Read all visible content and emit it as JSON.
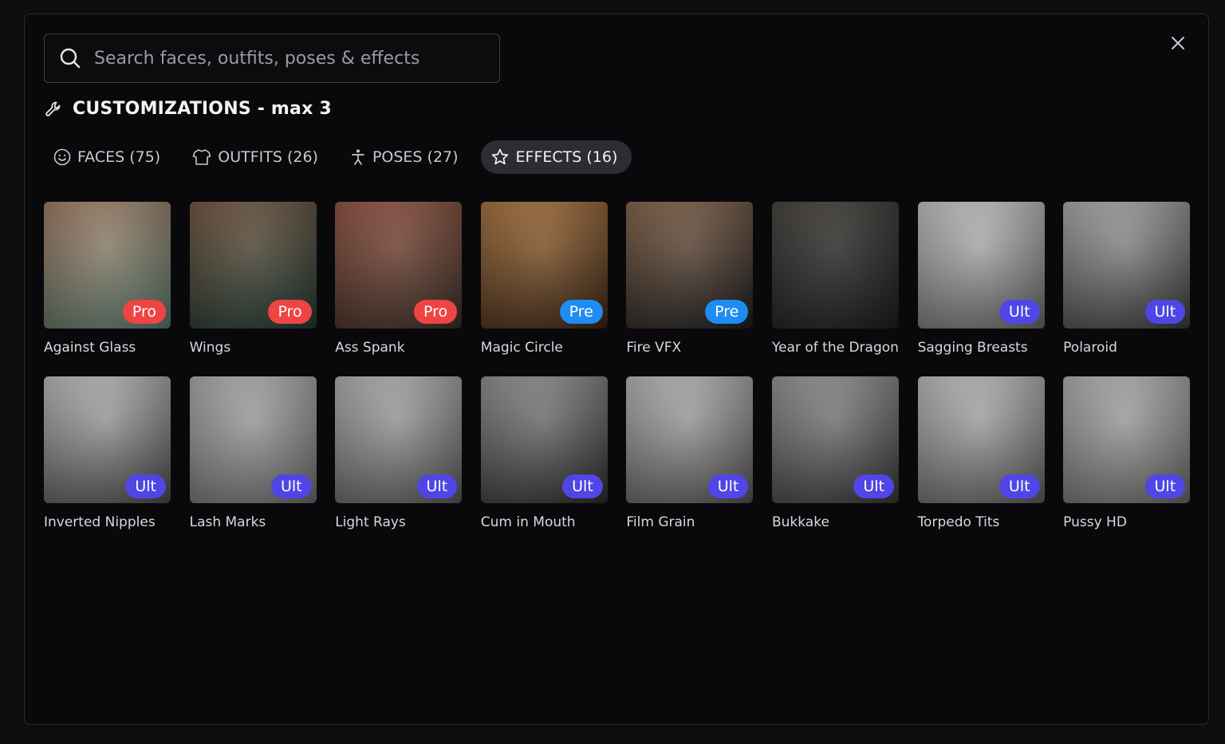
{
  "search": {
    "placeholder": "Search faces, outfits, poses & effects"
  },
  "heading": {
    "title": "CUSTOMIZATIONS - max 3"
  },
  "tabs": [
    {
      "label": "FACES (75)",
      "icon": "smiley-icon",
      "active": false
    },
    {
      "label": "OUTFITS (26)",
      "icon": "shirt-icon",
      "active": false
    },
    {
      "label": "POSES (27)",
      "icon": "figure-icon",
      "active": false
    },
    {
      "label": "EFFECTS (16)",
      "icon": "star-icon",
      "active": true
    }
  ],
  "badge_colors": {
    "Pro": "#ef4444",
    "Pre": "#1e8cf0",
    "Ult": "#4f46e5"
  },
  "effects": [
    {
      "label": "Against Glass",
      "badge": "Pro",
      "tone": [
        "#5c7a6e",
        "#a9846c"
      ]
    },
    {
      "label": "Wings",
      "badge": "Pro",
      "tone": [
        "#1f3a34",
        "#7a5c46"
      ]
    },
    {
      "label": "Ass Spank",
      "badge": "Pro",
      "tone": [
        "#3a2e26",
        "#9a5a48"
      ]
    },
    {
      "label": "Magic Circle",
      "badge": "Pre",
      "tone": [
        "#3a2414",
        "#b07a44"
      ]
    },
    {
      "label": "Fire VFX",
      "badge": "Pre",
      "tone": [
        "#1c1c1e",
        "#8a6a50"
      ]
    },
    {
      "label": "Year of the Dragon",
      "badge": "",
      "tone": [
        "#1a1c20",
        "#4a4640"
      ]
    },
    {
      "label": "Sagging Breasts",
      "badge": "Ult",
      "tone": [
        "#6a6a6a",
        "#cfcfcf"
      ]
    },
    {
      "label": "Polaroid",
      "badge": "Ult",
      "tone": [
        "#3a3a3a",
        "#b5b5b5"
      ]
    },
    {
      "label": "Inverted Nipples",
      "badge": "Ult",
      "tone": [
        "#4a4a4a",
        "#c8c8c8"
      ]
    },
    {
      "label": "Lash Marks",
      "badge": "Ult",
      "tone": [
        "#6e6e6e",
        "#b8b8b8"
      ]
    },
    {
      "label": "Light Rays",
      "badge": "Ult",
      "tone": [
        "#5a5a5a",
        "#bdbdbd"
      ]
    },
    {
      "label": "Cum in Mouth",
      "badge": "Ult",
      "tone": [
        "#2a2a2a",
        "#9c9c9c"
      ]
    },
    {
      "label": "Film Grain",
      "badge": "Ult",
      "tone": [
        "#555555",
        "#c4c4c4"
      ]
    },
    {
      "label": "Bukkake",
      "badge": "Ult",
      "tone": [
        "#353535",
        "#a0a0a0"
      ]
    },
    {
      "label": "Torpedo Tits",
      "badge": "Ult",
      "tone": [
        "#5e5e5e",
        "#cacaca"
      ]
    },
    {
      "label": "Pussy HD",
      "badge": "Ult",
      "tone": [
        "#6a6a6a",
        "#bcbcbc"
      ]
    }
  ]
}
